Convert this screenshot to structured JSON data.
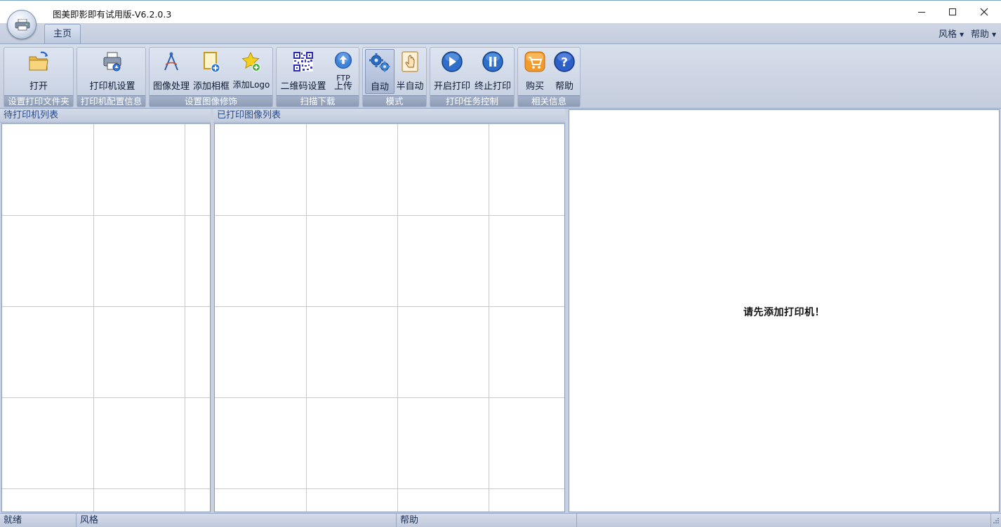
{
  "window": {
    "title": "图美即影即有试用版-V6.2.0.3",
    "controls": [
      "minimize",
      "maximize",
      "close"
    ]
  },
  "tabs": [
    {
      "label": "主页",
      "selected": true
    }
  ],
  "top_menus": [
    {
      "label": "风格"
    },
    {
      "label": "帮助"
    }
  ],
  "ribbon": {
    "groups": [
      {
        "label": "设置打印文件夹",
        "buttons": [
          {
            "label": "打开",
            "icon": "folder-open-icon"
          }
        ]
      },
      {
        "label": "打印机配置信息",
        "buttons": [
          {
            "label": "打印机设置",
            "icon": "printer-settings-icon"
          }
        ]
      },
      {
        "label": "设置图像修饰",
        "buttons": [
          {
            "label": "图像处理",
            "icon": "compass-tool-icon"
          },
          {
            "label": "添加相框",
            "icon": "add-frame-icon"
          },
          {
            "label": "添加Logo",
            "icon": "star-add-icon"
          }
        ]
      },
      {
        "label": "扫描下载",
        "buttons": [
          {
            "label": "二维码设置",
            "icon": "qr-code-icon"
          },
          {
            "label_line1": "FTP",
            "label_line2": "上传",
            "icon": "upload-arrow-icon"
          }
        ]
      },
      {
        "label": "模式",
        "buttons": [
          {
            "label": "自动",
            "icon": "gears-icon",
            "active": true
          },
          {
            "label": "半自动",
            "icon": "hand-pointer-icon"
          }
        ]
      },
      {
        "label": "打印任务控制",
        "buttons": [
          {
            "label": "开启打印",
            "icon": "play-icon"
          },
          {
            "label": "终止打印",
            "icon": "pause-icon"
          }
        ]
      },
      {
        "label": "相关信息",
        "buttons": [
          {
            "label": "购买",
            "icon": "cart-icon"
          },
          {
            "label": "帮助",
            "icon": "question-icon"
          }
        ]
      }
    ]
  },
  "panels": {
    "pending_printers": {
      "title": "待打印机列表"
    },
    "printed_images": {
      "title": "已打印图像列表"
    },
    "preview": {
      "message": "请先添加打印机！"
    }
  },
  "statusbar": [
    {
      "text": "就绪"
    },
    {
      "text": "风格"
    },
    {
      "text": "帮助"
    },
    {
      "text": ""
    }
  ],
  "colors": {
    "accent": "#2a4a86",
    "ribbon_label_bg": "#8d9bb5",
    "grid_line": "#c9c9c9"
  }
}
